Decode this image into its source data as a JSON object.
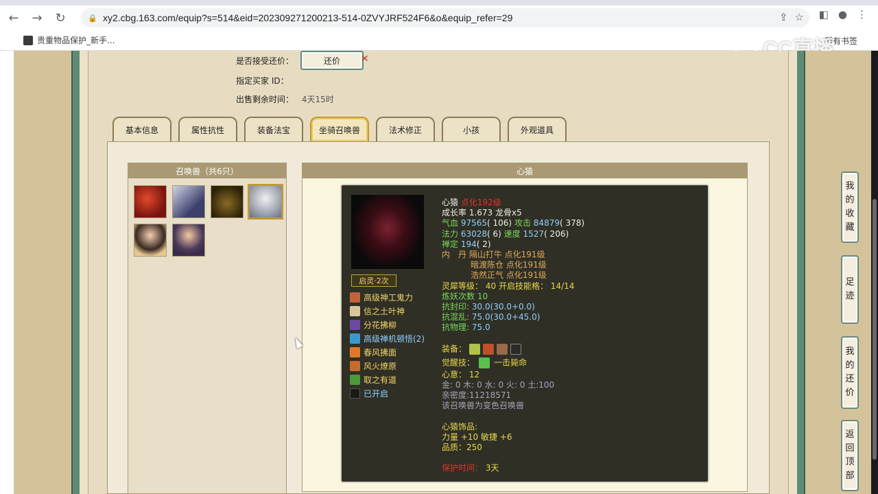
{
  "browser": {
    "url": "xy2.cbg.163.com/equip?s=514&eid=202309271200213-514-0ZVYJRF524F6&o&equip_refer=29",
    "bookmark": "贵重物品保护_新手...",
    "bookmark_right": "所有书签"
  },
  "watermark": "CC直播",
  "form": {
    "accept_counter_label": "是否接受还价：",
    "counter_button": "还价",
    "buyer_id_label": "指定买家 ID：",
    "time_left_label": "出售剩余时间：",
    "time_left_value": "4天15时"
  },
  "tabs": [
    {
      "label": "基本信息"
    },
    {
      "label": "属性抗性"
    },
    {
      "label": "装备法宝"
    },
    {
      "label": "坐骑召唤兽"
    },
    {
      "label": "法术修正"
    },
    {
      "label": "小孩"
    },
    {
      "label": "外观道具"
    }
  ],
  "pets_panel": {
    "title": "召唤兽（共6只）"
  },
  "detail_panel": {
    "title": "心猿"
  },
  "pet": {
    "name": "心猿",
    "name_suffix": "点化192级",
    "growth": "成长率 1.673 龙骨x5",
    "hp_label": "气血",
    "hp": "97565",
    "hp_extra": "( 106)",
    "atk_label": "攻击",
    "atk": "84879",
    "atk_extra": "( 378)",
    "mp_label": "法力",
    "mp": "63028",
    "mp_extra": "( 6)",
    "spd_label": "速度",
    "spd": "1527",
    "spd_extra": "( 206)",
    "def_label": "禅定",
    "def": "194",
    "def_extra": "( 2)",
    "dan_label": "内　丹",
    "dan1": "隔山打牛 点化191级",
    "dan2": "暗渡陈仓 点化191级",
    "dan3": "浩然正气 点化191级",
    "ling_label": "灵犀等级：",
    "ling_value": "40",
    "ling_open_label": "开启技能格：",
    "ling_open_value": "14/14",
    "refine": "炼妖次数 10",
    "resist1_label": "抗封印:",
    "resist1_value": "30.0(30.0+0.0)",
    "resist2_label": "抗混乱:",
    "resist2_value": "75.0(30.0+45.0)",
    "resist3_label": "抗物理:",
    "resist3_value": "75.0",
    "equip_label": "装备：",
    "awake_label": "觉醒技：",
    "awake_value": "一击毙命",
    "xinyi_label": "心意：",
    "xinyi_value": "12",
    "elements": "金: 0 木: 0 水: 0 火: 0 土:100",
    "intimacy": "亲密度:11218571",
    "color_note": "该召唤兽为变色召唤兽",
    "accessory_label": "心猿饰品:",
    "accessory_stats": "力量 +10 敏捷 +6",
    "quality": "品质：250",
    "protect_label": "保护时间：",
    "protect_value": "3天"
  },
  "qiling": "启灵·2次",
  "skills": [
    {
      "name": "高级神工鬼力",
      "color": "yellow"
    },
    {
      "name": "信之土叶神",
      "color": "yellow"
    },
    {
      "name": "分花拂柳",
      "color": "yellow"
    },
    {
      "name": "高级禅机顿悟(2)",
      "color": "blue"
    },
    {
      "name": "春风拂面",
      "color": "yellow"
    },
    {
      "name": "风火燎原",
      "color": "yellow"
    },
    {
      "name": "取之有道",
      "color": "yellow"
    },
    {
      "name": "已开启",
      "color": "blue"
    }
  ],
  "side_buttons": [
    {
      "chars": [
        "我",
        "的",
        "收",
        "藏"
      ]
    },
    {
      "chars": [
        "足",
        "迹"
      ]
    },
    {
      "chars": [
        "我",
        "的",
        "还",
        "价"
      ]
    },
    {
      "chars": [
        "返",
        "回",
        "顶",
        "部"
      ]
    }
  ]
}
